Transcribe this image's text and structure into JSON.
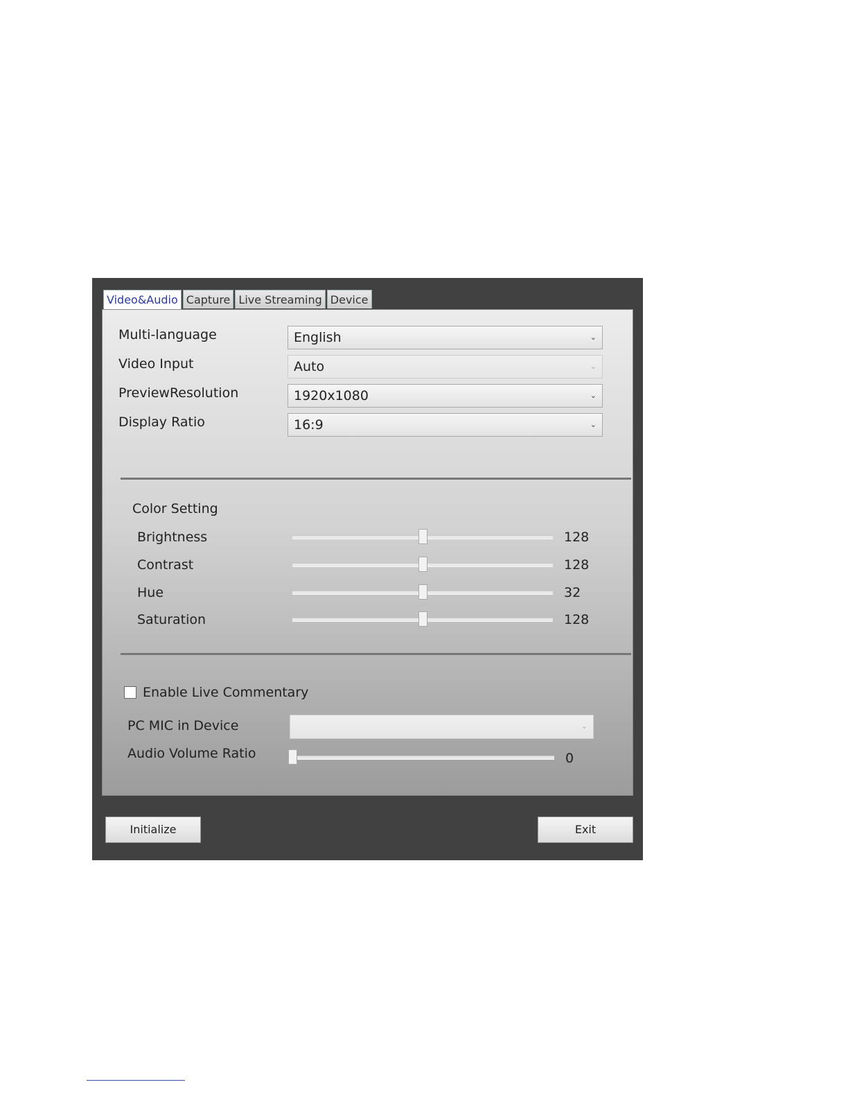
{
  "tabs": [
    {
      "label": "Video&Audio",
      "active": true
    },
    {
      "label": "Capture",
      "active": false
    },
    {
      "label": "Live Streaming",
      "active": false
    },
    {
      "label": "Device",
      "active": false
    }
  ],
  "settings": {
    "multi_language": {
      "label": "Multi-language",
      "value": "English"
    },
    "video_input": {
      "label": "Video Input",
      "value": "Auto"
    },
    "preview_resolution": {
      "label": "PreviewResolution",
      "value": "1920x1080"
    },
    "display_ratio": {
      "label": "Display Ratio",
      "value": "16:9"
    }
  },
  "color_setting": {
    "title": "Color Setting",
    "sliders": [
      {
        "label": "Brightness",
        "value": "128",
        "fraction": 0.5
      },
      {
        "label": "Contrast",
        "value": "128",
        "fraction": 0.5
      },
      {
        "label": "Hue",
        "value": "32",
        "fraction": 0.5
      },
      {
        "label": "Saturation",
        "value": "128",
        "fraction": 0.5
      }
    ]
  },
  "commentary": {
    "enable_label": "Enable Live Commentary",
    "enabled": false,
    "pc_mic_label": "PC MIC in Device",
    "pc_mic_value": "",
    "audio_volume_label": "Audio Volume Ratio",
    "audio_volume_value": "0",
    "audio_volume_fraction": 0
  },
  "buttons": {
    "initialize": "Initialize",
    "exit": "Exit"
  },
  "icons": {
    "dropdown": "chevron-down-icon",
    "checkbox": "checkbox-icon"
  }
}
